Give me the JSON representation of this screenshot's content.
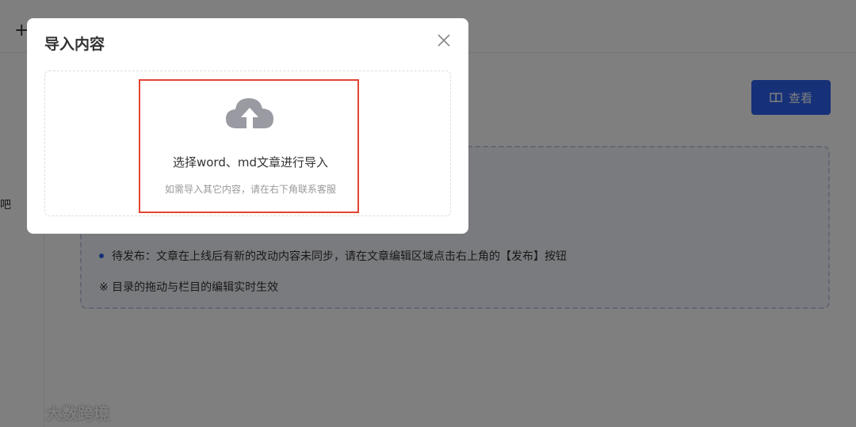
{
  "background": {
    "plus_icon": "plus-icon",
    "sidebar_text": "吧",
    "view_button_label": "查看",
    "info": {
      "line1": "待发布：文章在上线后有新的改动内容未同步，请在文章编辑区域点击右上角的【发布】按钮",
      "line2": "※ 目录的拖动与栏目的编辑实时生效"
    },
    "watermark": "大数跨境",
    "accent_color": "#2f62f0"
  },
  "modal": {
    "title": "导入内容",
    "upload_main": "选择word、md文章进行导入",
    "upload_sub": "如需导入其它内容，请在右下角联系客服",
    "highlight_color": "#e34433"
  }
}
